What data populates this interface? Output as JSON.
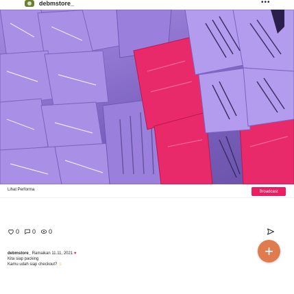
{
  "header": {
    "username": "debmstore_",
    "more_icon": "more-dots-icon"
  },
  "photo": {
    "subject": "stacked purple and pink plastic packaging bags"
  },
  "cta": {
    "label": "Lihat Performa",
    "button_label": "Broadcast",
    "button_color": "#e91e63"
  },
  "actions": {
    "like_count": "0",
    "comment_count": "0",
    "share_count": "0"
  },
  "caption": {
    "username": "debmstore_",
    "text": "Ramaikan 11.11, 2021",
    "line2": "Kita siap packing",
    "line3": "Kamu udah siap checkout?"
  },
  "colors": {
    "fab": "#e07a4f",
    "purple": "#9b82da",
    "pink": "#e0245f"
  }
}
